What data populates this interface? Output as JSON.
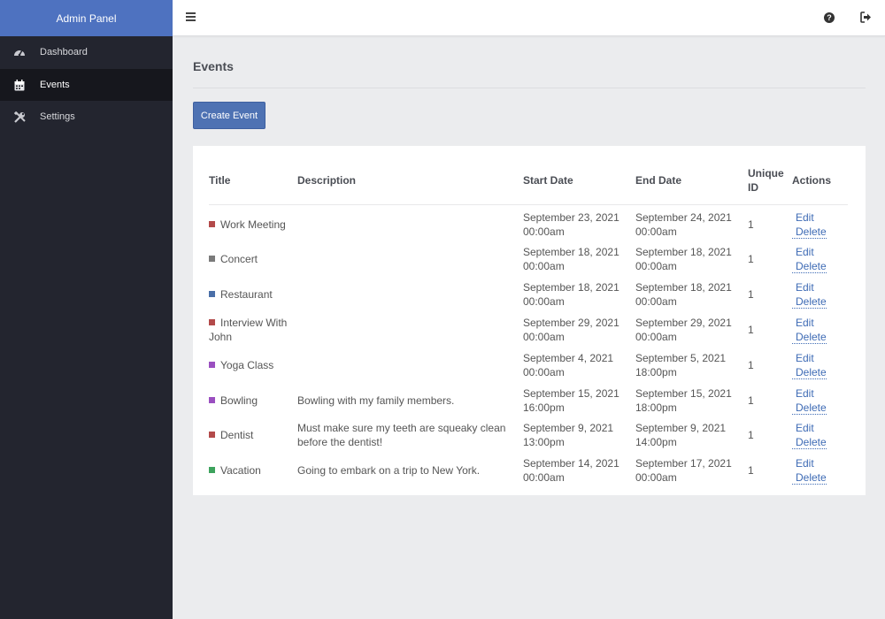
{
  "sidebar": {
    "brand": "Admin Panel",
    "items": [
      {
        "label": "Dashboard",
        "icon": "dashboard-gauge-icon"
      },
      {
        "label": "Events",
        "icon": "calendar-icon"
      },
      {
        "label": "Settings",
        "icon": "tools-icon"
      }
    ],
    "active": "Events"
  },
  "topbar": {
    "menu_icon": "hamburger-menu-icon",
    "help_icon": "question-circle-icon",
    "logout_icon": "sign-out-icon"
  },
  "main": {
    "page_title": "Events",
    "create_button": "Create Event",
    "table": {
      "headers": [
        "Title",
        "Description",
        "Start Date",
        "End Date",
        "Unique ID",
        "Actions"
      ],
      "edit_label": "Edit",
      "delete_label": "Delete",
      "rows": [
        {
          "title": "Work Meeting",
          "color": "#b34a4a",
          "description": "",
          "start_date": "September 23, 2021",
          "start_time": "00:00am",
          "end_date": "September 24, 2021",
          "end_time": "00:00am",
          "uid": "1"
        },
        {
          "title": "Concert",
          "color": "#7a7a7a",
          "description": "",
          "start_date": "September 18, 2021",
          "start_time": "00:00am",
          "end_date": "September 18, 2021",
          "end_time": "00:00am",
          "uid": "1"
        },
        {
          "title": "Restaurant",
          "color": "#4a6fa8",
          "description": "",
          "start_date": "September 18, 2021",
          "start_time": "00:00am",
          "end_date": "September 18, 2021",
          "end_time": "00:00am",
          "uid": "1"
        },
        {
          "title": "Interview With John",
          "color": "#b34a4a",
          "description": "",
          "start_date": "September 29, 2021",
          "start_time": "00:00am",
          "end_date": "September 29, 2021",
          "end_time": "00:00am",
          "uid": "1"
        },
        {
          "title": "Yoga Class",
          "color": "#9a4fc0",
          "description": "",
          "start_date": "September 4, 2021",
          "start_time": "00:00am",
          "end_date": "September 5, 2021",
          "end_time": "18:00pm",
          "uid": "1"
        },
        {
          "title": "Bowling",
          "color": "#9a4fc0",
          "description": "Bowling with my family members.",
          "start_date": "September 15, 2021",
          "start_time": "16:00pm",
          "end_date": "September 15, 2021",
          "end_time": "18:00pm",
          "uid": "1"
        },
        {
          "title": "Dentist",
          "color": "#b34a4a",
          "description": "Must make sure my teeth are squeaky clean before the dentist!",
          "start_date": "September 9, 2021",
          "start_time": "13:00pm",
          "end_date": "September 9, 2021",
          "end_time": "14:00pm",
          "uid": "1"
        },
        {
          "title": "Vacation",
          "color": "#3da35d",
          "description": "Going to embark on a trip to New York.",
          "start_date": "September 14, 2021",
          "start_time": "00:00am",
          "end_date": "September 17, 2021",
          "end_time": "00:00am",
          "uid": "1"
        }
      ]
    }
  }
}
